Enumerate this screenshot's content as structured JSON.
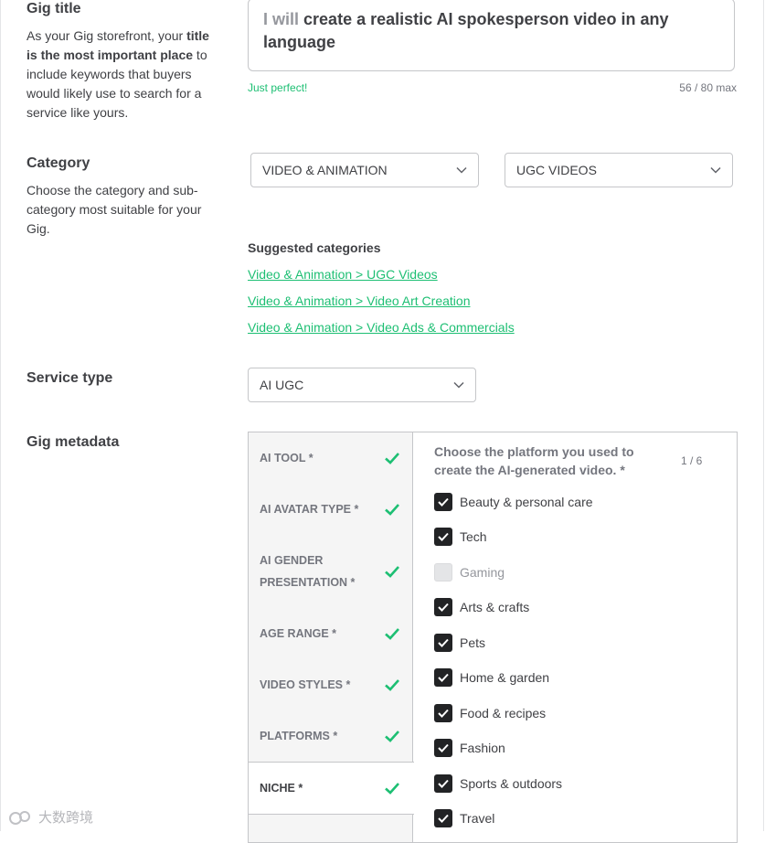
{
  "gig_title": {
    "label": "Gig title",
    "desc_1": "As your Gig storefront, your ",
    "desc_bold": "title is the most important place",
    "desc_2": " to include keywords that buyers would likely use to search for a service like yours.",
    "prefix": "I will",
    "value": "create a realistic AI spokesperson video in any language",
    "hint": "Just perfect!",
    "count": "56 / 80 max"
  },
  "category": {
    "label": "Category",
    "desc": "Choose the category and sub-category most suitable for your Gig.",
    "main_value": "VIDEO & ANIMATION",
    "sub_value": "UGC VIDEOS",
    "suggested_title": "Suggested categories",
    "suggested": [
      "Video & Animation > UGC Videos",
      "Video & Animation > Video Art Creation",
      "Video & Animation > Video Ads & Commercials"
    ]
  },
  "service_type": {
    "label": "Service type",
    "value": "AI UGC"
  },
  "metadata": {
    "label": "Gig metadata",
    "tabs": [
      {
        "label": "AI TOOL *",
        "done": true
      },
      {
        "label": "AI AVATAR TYPE *",
        "done": true
      },
      {
        "label": "AI GENDER PRESENTATION *",
        "done": true
      },
      {
        "label": "AGE RANGE *",
        "done": true
      },
      {
        "label": "VIDEO STYLES *",
        "done": true
      },
      {
        "label": "PLATFORMS *",
        "done": true
      },
      {
        "label": "NICHE *",
        "done": true
      }
    ],
    "question": "Choose the platform you used to create the AI-generated video. *",
    "count": "1 / 6",
    "options": [
      {
        "label": "Beauty & personal care",
        "checked": true
      },
      {
        "label": "Tech",
        "checked": true
      },
      {
        "label": "Gaming",
        "checked": false
      },
      {
        "label": "Arts & crafts",
        "checked": true
      },
      {
        "label": "Pets",
        "checked": true
      },
      {
        "label": "Home & garden",
        "checked": true
      },
      {
        "label": "Food & recipes",
        "checked": true
      },
      {
        "label": "Fashion",
        "checked": true
      },
      {
        "label": "Sports & outdoors",
        "checked": true
      },
      {
        "label": "Travel",
        "checked": true
      }
    ]
  },
  "colors": {
    "accent": "#1dbf73",
    "text": "#404145",
    "muted": "#74767e",
    "checkbox": "#222325"
  },
  "watermark": {
    "text": "大数跨境"
  }
}
